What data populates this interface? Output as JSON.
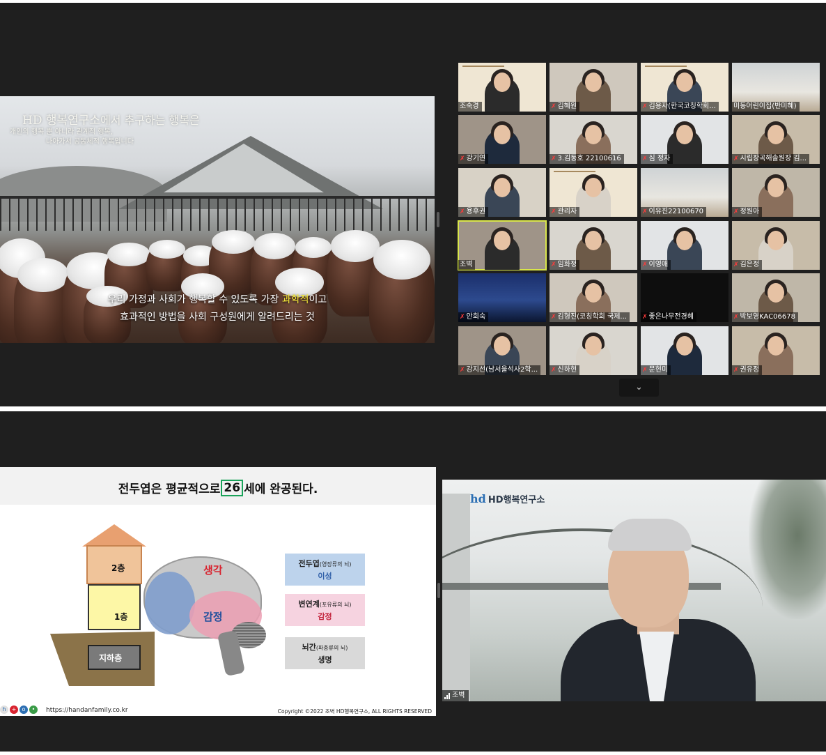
{
  "top_meeting": {
    "shared_slide": {
      "heading_line1_brand": "HD 행복연구소",
      "heading_line1_rest": "에서 추구하는 행복은",
      "heading_line2": "개인의 행복 뿐 아니라 관계적 행복,",
      "heading_line3": "나아가서 공동체적 행복입니다",
      "caption_line1_before": "우리 가정과 사회가 행복할 수 있도록 가장 ",
      "caption_line1_highlight": "과학적",
      "caption_line1_after": "이고",
      "caption_line2": "효과적인 방법을 사회 구성원에게 알려드리는 것"
    },
    "participants": [
      {
        "name": "조숙경",
        "muted": false,
        "kind": "slide"
      },
      {
        "name": "김혜원",
        "muted": true,
        "kind": "person"
      },
      {
        "name": "김용자(한국코칭학회...",
        "muted": true,
        "kind": "slide"
      },
      {
        "name": "미동어린이집(반미혜)",
        "muted": false,
        "kind": "room"
      },
      {
        "name": "강기연",
        "muted": true,
        "kind": "person"
      },
      {
        "name": "3.김동호 22100616",
        "muted": true,
        "kind": "person"
      },
      {
        "name": "심 정자",
        "muted": true,
        "kind": "person"
      },
      {
        "name": "시립장곡해솔원장 김...",
        "muted": true,
        "kind": "person"
      },
      {
        "name": "용후권",
        "muted": true,
        "kind": "person"
      },
      {
        "name": "관리자",
        "muted": true,
        "kind": "slide"
      },
      {
        "name": "이유진22100670",
        "muted": true,
        "kind": "room"
      },
      {
        "name": "정원아",
        "muted": true,
        "kind": "person"
      },
      {
        "name": "조벽",
        "muted": false,
        "kind": "person",
        "active": true
      },
      {
        "name": "임화정",
        "muted": true,
        "kind": "person"
      },
      {
        "name": "이영애",
        "muted": true,
        "kind": "person"
      },
      {
        "name": "김은정",
        "muted": true,
        "kind": "person"
      },
      {
        "name": "안회숙",
        "muted": true,
        "kind": "night"
      },
      {
        "name": "김형진(코칭학회 국제...",
        "muted": true,
        "kind": "person"
      },
      {
        "name": "좋은나무전경혜",
        "muted": true,
        "kind": "black"
      },
      {
        "name": "박보영KAC06678",
        "muted": true,
        "kind": "person"
      },
      {
        "name": "강지선(남서울석사2학...",
        "muted": true,
        "kind": "person"
      },
      {
        "name": "신하현",
        "muted": true,
        "kind": "person"
      },
      {
        "name": "문현미",
        "muted": true,
        "kind": "person"
      },
      {
        "name": "권유정",
        "muted": true,
        "kind": "person"
      }
    ],
    "scroll_icon": "chevron-down-icon"
  },
  "bottom_meeting": {
    "lecture_slide": {
      "title_before": "전두엽은 평균적으로 ",
      "title_boxed": "26",
      "title_after": "세에 완공된다.",
      "floor_2": "2층",
      "floor_1": "1층",
      "floor_basement": "지하층",
      "brain_thought": "생각",
      "brain_emotion": "감정",
      "boxes": [
        {
          "title": "전두엽",
          "detail": "(영장류의 뇌)",
          "role": "이성",
          "bg": "#bdd3ec",
          "role_color": "#2f5fa8"
        },
        {
          "title": "변연계",
          "detail": "(포유류의 뇌)",
          "role": "감정",
          "bg": "#f6d3e0",
          "role_color": "#c2203a"
        },
        {
          "title": "뇌간",
          "detail": "(파충류의 뇌)",
          "role": "생명",
          "bg": "#d9d9d9",
          "role_color": "#222222"
        }
      ],
      "footer_url": "https://handanfamily.co.kr",
      "footer_copyright": "Copyright ©2022 조벽 HD행복연구소, ALL RIGHTS RESERVED"
    },
    "speaker_video": {
      "logo_mark": "hd",
      "logo_text": "HD행복연구소",
      "name": "조벽"
    }
  },
  "colors": {
    "meeting_bg": "#1f1f1f",
    "active_speaker_border": "#d9e64a",
    "caption_highlight": "#fff23a",
    "muted_icon": "#ff3b3b",
    "title_box_border": "#1aa35a"
  }
}
